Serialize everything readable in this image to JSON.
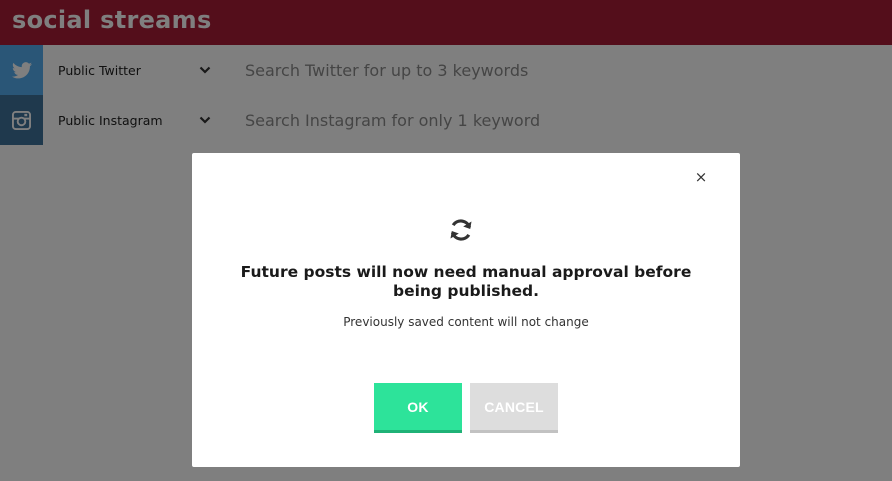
{
  "header": {
    "title": "social streams"
  },
  "streams": [
    {
      "icon": "twitter-icon",
      "source": "Public Twitter",
      "placeholder": "Search Twitter for up to 3 keywords",
      "value": ""
    },
    {
      "icon": "instagram-icon",
      "source": "Public Instagram",
      "placeholder": "Search Instagram for only 1 keyword",
      "value": ""
    }
  ],
  "modal": {
    "close_label": "×",
    "icon": "refresh-icon",
    "heading_line1": "Future posts will now need manual approval before",
    "heading_line2": "being published.",
    "subtext": "Previously saved content will not change",
    "ok_label": "OK",
    "cancel_label": "CANCEL"
  },
  "colors": {
    "header": "#a81c37",
    "twitter": "#55acee",
    "instagram": "#3f729b",
    "ok": "#2de39a",
    "cancel": "#dddddd"
  }
}
